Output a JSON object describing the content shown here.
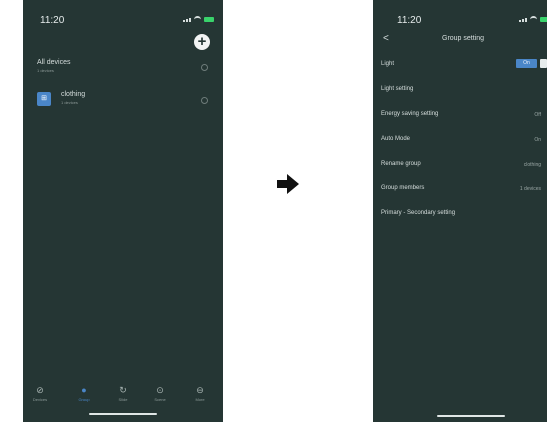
{
  "left_phone": {
    "status_time": "11:20",
    "add_button": "+",
    "all_devices": {
      "title": "All devices",
      "subtitle": "1 devices"
    },
    "group": {
      "title": "clothing",
      "subtitle": "1 devices"
    },
    "tabs": [
      {
        "label": "Devices",
        "icon": "leaf-icon",
        "glyph": "⊘"
      },
      {
        "label": "Group",
        "icon": "group-dot-icon",
        "glyph": "●"
      },
      {
        "label": "Slide",
        "icon": "refresh-icon",
        "glyph": "↻"
      },
      {
        "label": "Scene",
        "icon": "scene-icon",
        "glyph": "⊙"
      },
      {
        "label": "More",
        "icon": "more-icon",
        "glyph": "⊖"
      }
    ]
  },
  "right_phone": {
    "status_time": "11:20",
    "back_glyph": "<",
    "title": "Group setting",
    "toggle_label": "On",
    "settings": [
      {
        "label": "Light",
        "value": ""
      },
      {
        "label": "Light setting",
        "value": ""
      },
      {
        "label": "Energy saving setting",
        "value": "Off"
      },
      {
        "label": "Auto Mode",
        "value": "On"
      },
      {
        "label": "Rename group",
        "value": "clothing"
      },
      {
        "label": "Group members",
        "value": "1 devices"
      },
      {
        "label": "Primary - Secondary setting",
        "value": ""
      }
    ]
  },
  "colors": {
    "screen_bg": "#253634",
    "accent_blue": "#4a86c8",
    "battery_green": "#39d36b"
  }
}
